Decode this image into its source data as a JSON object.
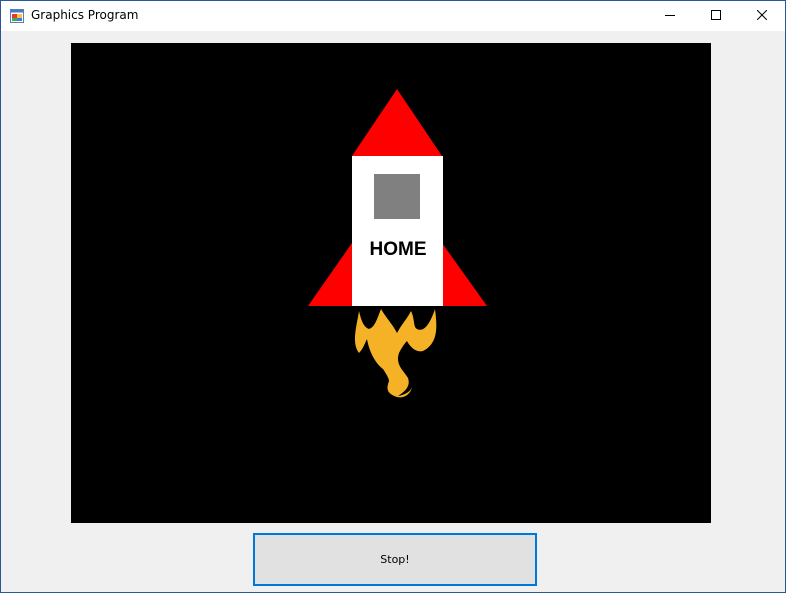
{
  "window": {
    "title": "Graphics Program"
  },
  "canvas": {
    "label": "HOME",
    "colors": {
      "background": "#000000",
      "nose_cone": "#ff0000",
      "fins": "#ff0000",
      "body": "#ffffff",
      "porthole": "#808080",
      "flame": "#f5b227"
    }
  },
  "stop_button": {
    "label": "Stop!"
  },
  "icons": {
    "app": "app-window-icon",
    "minimize": "minimize-icon",
    "maximize": "maximize-icon",
    "close": "close-icon"
  }
}
